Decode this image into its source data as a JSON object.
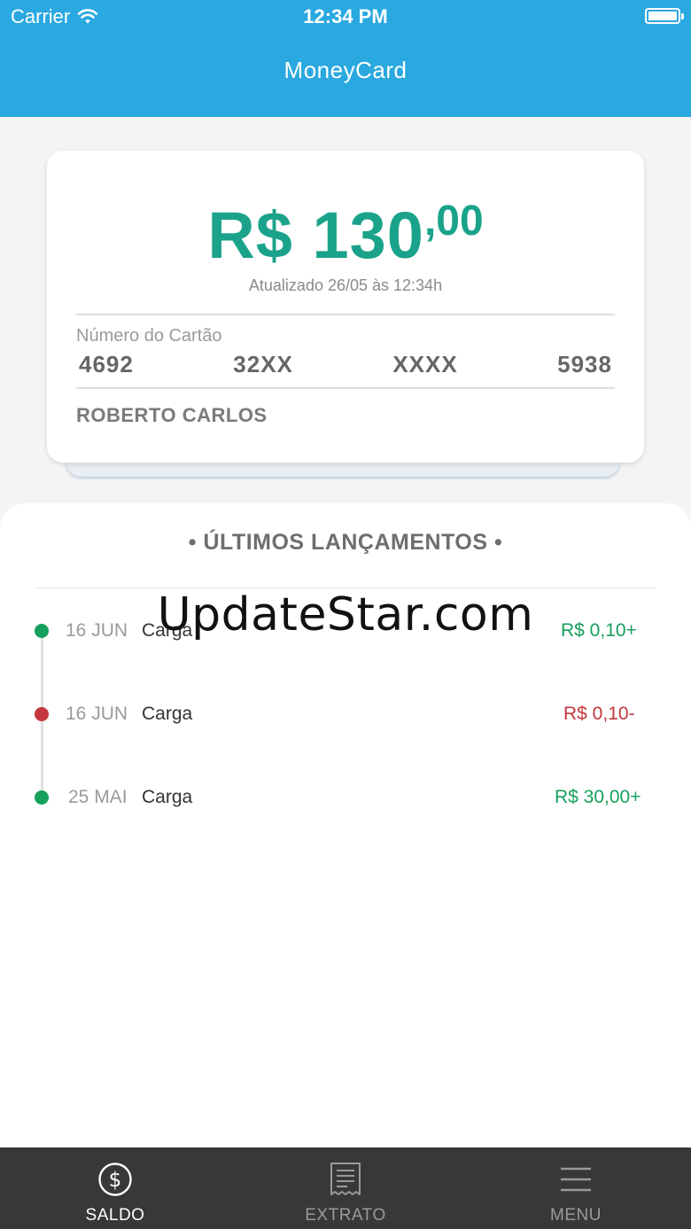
{
  "status_bar": {
    "carrier": "Carrier",
    "time": "12:34 PM"
  },
  "header": {
    "title": "MoneyCard"
  },
  "card": {
    "balance_main": "R$ 130",
    "balance_cents": ",00",
    "updated": "Atualizado 26/05 às 12:34h",
    "number_label": "Número do Cartão",
    "number_groups": [
      "4692",
      "32XX",
      "XXXX",
      "5938"
    ],
    "holder": "ROBERTO CARLOS"
  },
  "transactions": {
    "title": "• ÚLTIMOS LANÇAMENTOS •",
    "items": [
      {
        "date": "16 JUN",
        "description": "Carga",
        "amount": "R$ 0,10+",
        "type": "credit"
      },
      {
        "date": "16 JUN",
        "description": "Carga",
        "amount": "R$ 0,10-",
        "type": "debit"
      },
      {
        "date": "25 MAI",
        "description": "Carga",
        "amount": "R$ 30,00+",
        "type": "credit"
      }
    ]
  },
  "watermark": "UpdateStar.com",
  "tabbar": {
    "tabs": [
      {
        "label": "SALDO",
        "icon": "dollar-circle-icon",
        "active": true
      },
      {
        "label": "EXTRATO",
        "icon": "receipt-icon",
        "active": false
      },
      {
        "label": "MENU",
        "icon": "hamburger-menu-icon",
        "active": false
      }
    ]
  },
  "colors": {
    "header_bg": "#2aa8e0",
    "balance": "#1aa38a",
    "credit": "#17a05d",
    "debit": "#c4373d",
    "tabbar_bg": "#383838",
    "tab_active": "#ffffff",
    "tab_inactive": "#9a9a9a"
  }
}
